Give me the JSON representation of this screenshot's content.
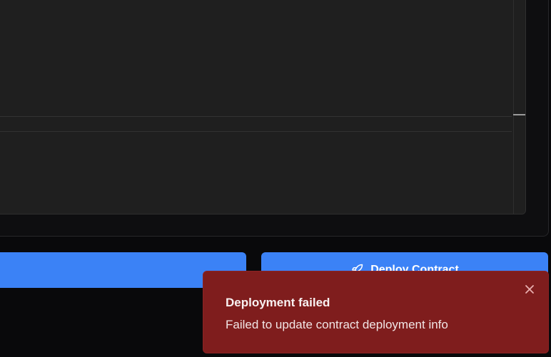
{
  "deploy_button": {
    "label": "Deploy Contract",
    "icon": "rocket-icon"
  },
  "toast": {
    "title": "Deployment failed",
    "description": "Failed to update contract deployment info",
    "close_icon": "close-icon",
    "background_color": "#7f1d1d"
  },
  "colors": {
    "accent": "#3b82f6",
    "background": "#09090b",
    "editor_background": "#1f1f1f"
  }
}
